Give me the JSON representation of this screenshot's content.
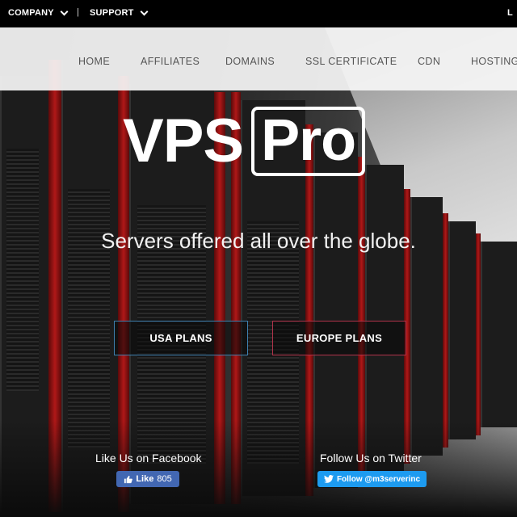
{
  "topbar": {
    "company": "COMPANY",
    "separator": "|",
    "support": "SUPPORT",
    "right_fragment": "L"
  },
  "nav": {
    "items": [
      "HOME",
      "AFFILIATES",
      "DOMAINS",
      "SSL CERTIFICATE",
      "CDN",
      "HOSTING"
    ]
  },
  "hero": {
    "logo_part1": "VPS",
    "logo_part2": "Pro",
    "tagline": "Servers offered all over the globe.",
    "cta_usa": "USA PLANS",
    "cta_europe": "EUROPE PLANS"
  },
  "social": {
    "facebook_label": "Like Us on Facebook",
    "facebook_button": "Like",
    "facebook_count": "805",
    "twitter_label": "Follow Us on Twitter",
    "twitter_button": "Follow @m3serverinc"
  },
  "icons": {
    "facebook": "thumbs-up-icon",
    "twitter": "twitter-bird-icon"
  },
  "colors": {
    "usa_border": "#3e7fae",
    "europe_border": "#b0334a",
    "facebook": "#4267b2",
    "twitter": "#1d9bf0"
  }
}
